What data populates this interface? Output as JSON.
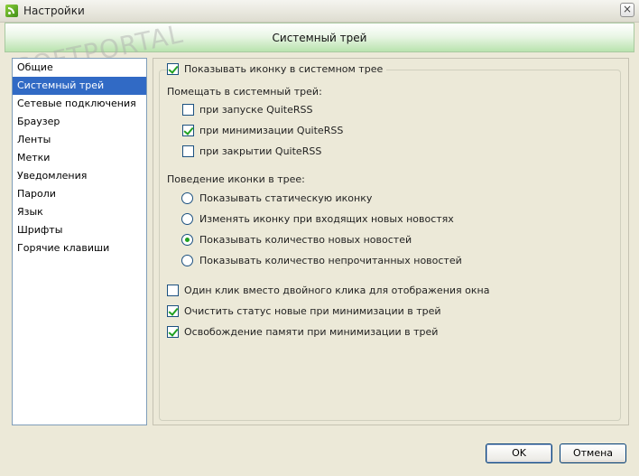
{
  "window": {
    "title": "Настройки",
    "close_label": "×"
  },
  "header": {
    "title": "Системный трей",
    "watermark": "SOFTPORTAL"
  },
  "sidebar": {
    "items": [
      {
        "label": "Общие"
      },
      {
        "label": "Системный трей"
      },
      {
        "label": "Сетевые подключения"
      },
      {
        "label": "Браузер"
      },
      {
        "label": "Ленты"
      },
      {
        "label": "Метки"
      },
      {
        "label": "Уведомления"
      },
      {
        "label": "Пароли"
      },
      {
        "label": "Язык"
      },
      {
        "label": "Шрифты"
      },
      {
        "label": "Горячие клавиши"
      }
    ],
    "selected_index": 1
  },
  "tray": {
    "show_icon": {
      "label": "Показывать иконку в системном трее",
      "checked": true
    },
    "place_label": "Помещать в системный трей:",
    "place_options": [
      {
        "label": "при запуске QuiteRSS",
        "checked": false
      },
      {
        "label": "при минимизации QuiteRSS",
        "checked": true
      },
      {
        "label": "при закрытии QuiteRSS",
        "checked": false
      }
    ],
    "behavior_label": "Поведение иконки в трее:",
    "behavior_options": [
      {
        "label": "Показывать статическую иконку",
        "selected": false
      },
      {
        "label": "Изменять иконку при входящих новых новостях",
        "selected": false
      },
      {
        "label": "Показывать количество новых новостей",
        "selected": true
      },
      {
        "label": "Показывать количество непрочитанных новостей",
        "selected": false
      }
    ],
    "extra_options": [
      {
        "label": "Один клик вместо двойного клика для отображения окна",
        "checked": false
      },
      {
        "label": "Очистить статус новые при минимизации в трей",
        "checked": true
      },
      {
        "label": "Освобождение памяти при минимизации в трей",
        "checked": true
      }
    ]
  },
  "buttons": {
    "ok": "OK",
    "cancel": "Отмена"
  },
  "colors": {
    "selection": "#316ac5",
    "header_green": "#b9e3ae",
    "check_green": "#21a121"
  }
}
